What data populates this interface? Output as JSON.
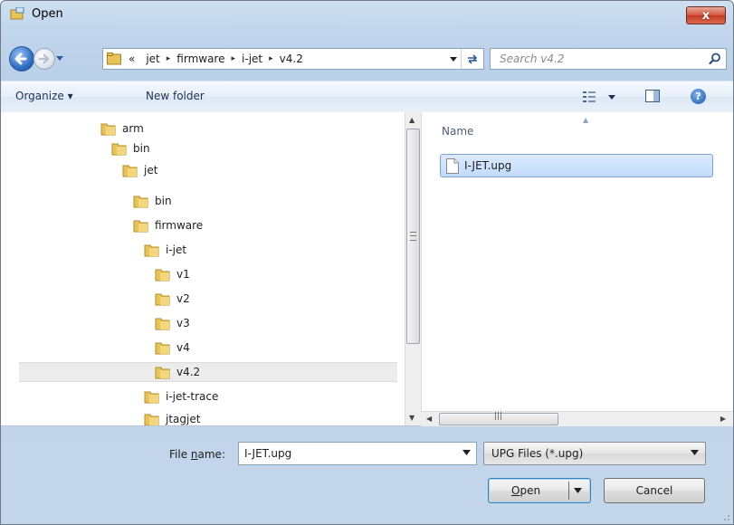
{
  "window": {
    "title": "Open",
    "close_label": "x"
  },
  "address_bar": {
    "overflow_marker": "«",
    "crumbs": [
      "jet",
      "firmware",
      "i-jet",
      "v4.2"
    ],
    "separator": "▸"
  },
  "search": {
    "placeholder": "Search v4.2"
  },
  "toolbar": {
    "organize_label": "Organize ▾",
    "new_folder_label": "New folder",
    "help_label": "?"
  },
  "tree": {
    "items": [
      {
        "label": "arm"
      },
      {
        "label": "bin"
      },
      {
        "label": "jet"
      },
      {
        "label": "bin"
      },
      {
        "label": "firmware"
      },
      {
        "label": "i-jet"
      },
      {
        "label": "v1"
      },
      {
        "label": "v2"
      },
      {
        "label": "v3"
      },
      {
        "label": "v4"
      },
      {
        "label": "v4.2",
        "selected": true
      },
      {
        "label": "i-jet-trace"
      },
      {
        "label": "jtagjet"
      }
    ]
  },
  "file_list": {
    "column_name": "Name",
    "files": [
      {
        "name": "I-JET.upg",
        "selected": true
      }
    ]
  },
  "file_name": {
    "label_prefix": "File ",
    "label_accel": "n",
    "label_suffix": "ame:",
    "value": "I-JET.upg"
  },
  "file_type": {
    "value": "UPG Files (*.upg)"
  },
  "buttons": {
    "open_accel": "O",
    "open_rest": "pen",
    "cancel": "Cancel"
  },
  "colors": {
    "folder": "#e8c35a",
    "selection": "#c1dbfc",
    "accent": "#3c7fb1"
  },
  "icons": [
    "open-dialog-icon",
    "close-icon",
    "back-arrow-icon",
    "forward-arrow-icon",
    "folder-icon",
    "refresh-icon",
    "search-icon",
    "view-options-icon",
    "preview-pane-icon",
    "help-icon",
    "document-icon",
    "chevron-down-icon"
  ]
}
